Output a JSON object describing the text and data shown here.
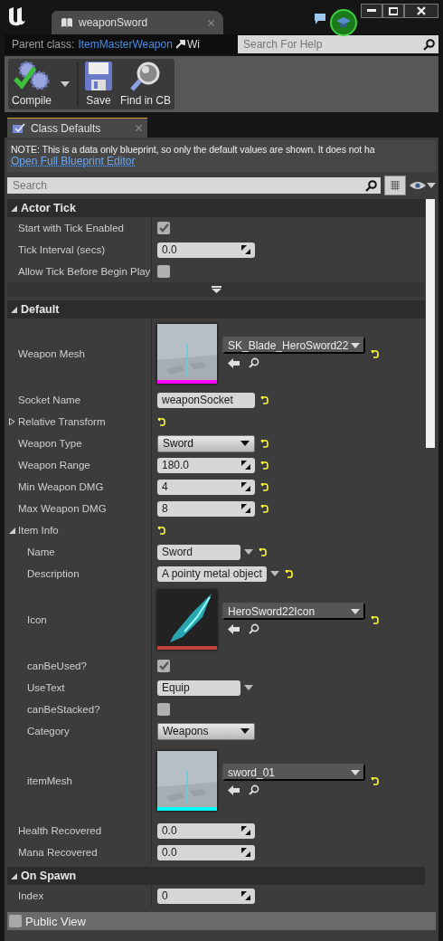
{
  "window": {
    "tab_title": "weaponSword",
    "parent_class_label": "Parent class:",
    "parent_class_value": "ItemMasterWeapon",
    "menu_cut": "Wi",
    "help_search": {
      "placeholder": "Search For Help"
    }
  },
  "toolbar": [
    {
      "kind": "compile",
      "label": "Compile"
    },
    {
      "kind": "save",
      "label": "Save"
    },
    {
      "kind": "find",
      "label": "Find in CB"
    }
  ],
  "panel_tab": {
    "title": "Class Defaults"
  },
  "note": {
    "text": "NOTE: This is a data only blueprint, so only the default values are shown.  It does not ha",
    "link": "Open Full Blueprint Editor"
  },
  "search": {
    "placeholder": "Search"
  },
  "sections": [
    {
      "title": "Actor Tick",
      "expanded": true,
      "advanced_toggle": true,
      "rows": [
        {
          "kind": "checkbox",
          "label": "Start with Tick Enabled",
          "checked": true,
          "reset": false
        },
        {
          "kind": "number",
          "label": "Tick Interval (secs)",
          "value": "0.0",
          "reset": false
        },
        {
          "kind": "checkbox",
          "label": "Allow Tick Before Begin Play",
          "checked": false,
          "reset": false
        }
      ]
    },
    {
      "title": "Default",
      "expanded": true,
      "advanced_toggle": false,
      "rows": [
        {
          "kind": "mesh",
          "label": "Weapon Mesh",
          "value": "SK_Blade_HeroSword22",
          "color": "#ff00ff",
          "reset": true
        },
        {
          "kind": "text",
          "label": "Socket Name",
          "value": "weaponSocket",
          "reset": true
        },
        {
          "kind": "group",
          "label": "Relative Transform",
          "expanded": false,
          "reset": true,
          "children": []
        },
        {
          "kind": "combo",
          "label": "Weapon Type",
          "value": "Sword",
          "reset": true
        },
        {
          "kind": "number",
          "label": "Weapon Range",
          "value": "180.0",
          "reset": true
        },
        {
          "kind": "number",
          "label": "Min Weapon DMG",
          "value": "4",
          "reset": true
        },
        {
          "kind": "number",
          "label": "Max Weapon DMG",
          "value": "8",
          "reset": true
        },
        {
          "kind": "group",
          "label": "Item Info",
          "expanded": true,
          "reset": true,
          "children": [
            {
              "kind": "editcombo",
              "label": "Name",
              "value": "Sword",
              "reset": true
            },
            {
              "kind": "editcombo",
              "label": "Description",
              "value": "A pointy metal object",
              "reset": true
            },
            {
              "kind": "texture",
              "label": "Icon",
              "value": "HeroSword22Icon",
              "color": "#c0403c",
              "reset": true
            },
            {
              "kind": "checkbox",
              "label": "canBeUsed?",
              "checked": true,
              "reset": false
            },
            {
              "kind": "editcombo",
              "label": "UseText",
              "value": "Equip",
              "reset": false
            },
            {
              "kind": "checkbox",
              "label": "canBeStacked?",
              "checked": false,
              "reset": false
            },
            {
              "kind": "combo",
              "label": "Category",
              "value": "Weapons",
              "reset": false
            },
            {
              "kind": "mesh",
              "label": "itemMesh",
              "value": "sword_01",
              "color": "#00ffff",
              "reset": true
            }
          ]
        },
        {
          "kind": "number",
          "label": "Health Recovered",
          "value": "0.0",
          "reset": false
        },
        {
          "kind": "number",
          "label": "Mana Recovered",
          "value": "0.0",
          "reset": false
        }
      ]
    },
    {
      "title": "On Spawn",
      "expanded": true,
      "advanced_toggle": false,
      "rows": [
        {
          "kind": "number",
          "label": "Index",
          "value": "0",
          "reset": false
        }
      ]
    }
  ],
  "footer": {
    "label": "Public View",
    "checked": false
  }
}
